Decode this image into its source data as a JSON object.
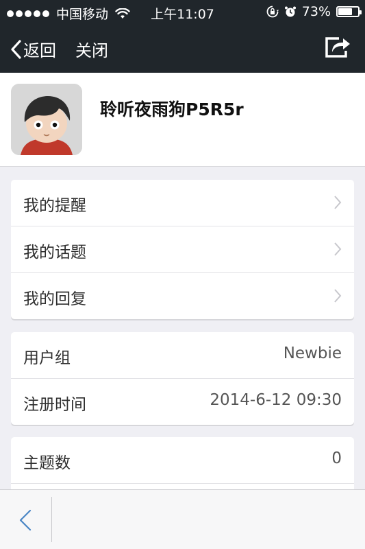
{
  "status_bar": {
    "carrier": "中国移动",
    "time": "上午11:07",
    "battery_percent_text": "73%",
    "battery_level": 0.73,
    "icons": [
      "signal-dots-icon",
      "wifi-icon",
      "rotation-lock-icon",
      "alarm-icon",
      "battery-icon"
    ]
  },
  "nav": {
    "back_label": "返回",
    "close_label": "关闭",
    "share_icon": "share-icon"
  },
  "profile": {
    "username": "聆听夜雨狗P5R5r",
    "avatar_icon": "cartoon-avatar"
  },
  "menu_links": [
    {
      "label": "我的提醒"
    },
    {
      "label": "我的话题"
    },
    {
      "label": "我的回复"
    }
  ],
  "account_info": [
    {
      "label": "用户组",
      "value": "Newbie"
    },
    {
      "label": "注册时间",
      "value": "2014-6-12 09:30"
    }
  ],
  "stats": [
    {
      "label": "主题数",
      "value": "0"
    }
  ],
  "toolbar": {
    "back_icon": "chevron-left-icon"
  },
  "colors": {
    "topbar": "#20262b",
    "background": "#efeff4",
    "toolbar_back": "#4a86c5"
  }
}
